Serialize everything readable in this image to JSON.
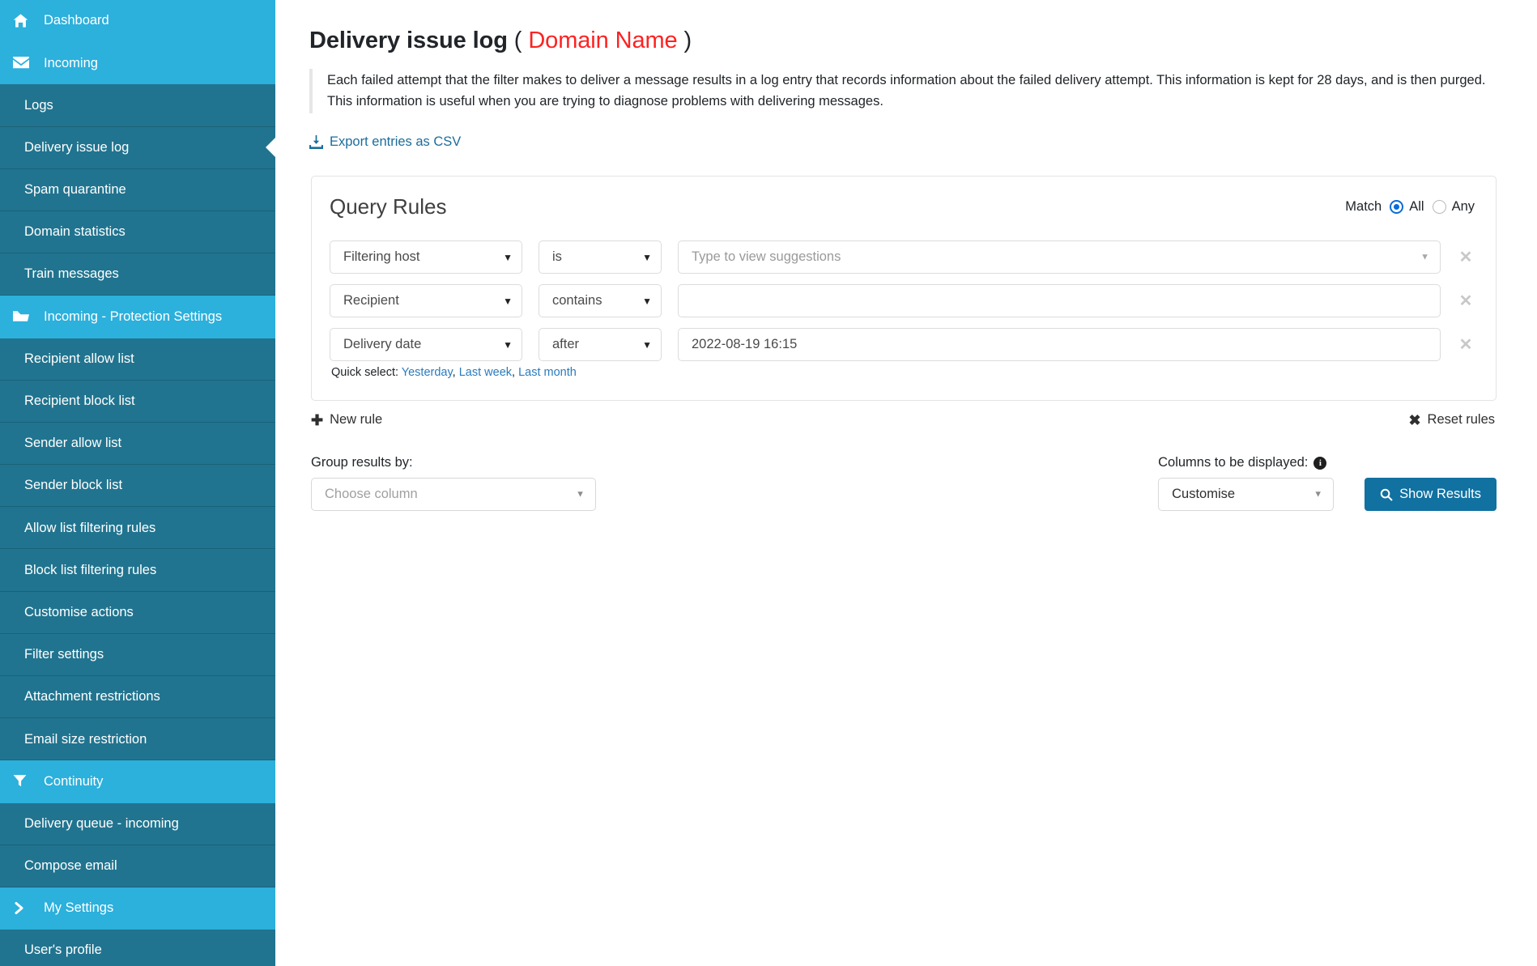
{
  "sidebar": {
    "items": [
      {
        "label": "Dashboard",
        "type": "group",
        "icon": "home-icon",
        "key": "dashboard"
      },
      {
        "label": "Incoming",
        "type": "group",
        "icon": "envelope-icon",
        "key": "incoming"
      },
      {
        "label": "Logs",
        "type": "child",
        "active": false,
        "key": "logs"
      },
      {
        "label": "Delivery issue log",
        "type": "child",
        "active": true,
        "key": "delivery-issue-log"
      },
      {
        "label": "Spam quarantine",
        "type": "child",
        "active": false,
        "key": "spam-quarantine"
      },
      {
        "label": "Domain statistics",
        "type": "child",
        "active": false,
        "key": "domain-statistics"
      },
      {
        "label": "Train messages",
        "type": "child",
        "active": false,
        "key": "train-messages"
      },
      {
        "label": "Incoming - Protection Settings",
        "type": "group",
        "icon": "folder-icon",
        "key": "incoming-protection-settings"
      },
      {
        "label": "Recipient allow list",
        "type": "child",
        "active": false,
        "key": "recipient-allow-list"
      },
      {
        "label": "Recipient block list",
        "type": "child",
        "active": false,
        "key": "recipient-block-list"
      },
      {
        "label": "Sender allow list",
        "type": "child",
        "active": false,
        "key": "sender-allow-list"
      },
      {
        "label": "Sender block list",
        "type": "child",
        "active": false,
        "key": "sender-block-list"
      },
      {
        "label": "Allow list filtering rules",
        "type": "child",
        "active": false,
        "key": "allow-list-filtering-rules"
      },
      {
        "label": "Block list filtering rules",
        "type": "child",
        "active": false,
        "key": "block-list-filtering-rules"
      },
      {
        "label": "Customise actions",
        "type": "child",
        "active": false,
        "key": "customise-actions"
      },
      {
        "label": "Filter settings",
        "type": "child",
        "active": false,
        "key": "filter-settings"
      },
      {
        "label": "Attachment restrictions",
        "type": "child",
        "active": false,
        "key": "attachment-restrictions"
      },
      {
        "label": "Email size restriction",
        "type": "child",
        "active": false,
        "key": "email-size-restriction"
      },
      {
        "label": "Continuity",
        "type": "group",
        "icon": "filter-icon",
        "key": "continuity"
      },
      {
        "label": "Delivery queue - incoming",
        "type": "child",
        "active": false,
        "key": "delivery-queue-incoming"
      },
      {
        "label": "Compose email",
        "type": "child",
        "active": false,
        "key": "compose-email"
      },
      {
        "label": "My Settings",
        "type": "group",
        "icon": "chevron-right-icon",
        "key": "my-settings"
      },
      {
        "label": "User's profile",
        "type": "child",
        "active": false,
        "key": "users-profile"
      }
    ],
    "colors": {
      "group_bg": "#2cb0dc",
      "child_bg": "#21748f",
      "divider": "#1a6278",
      "text": "#ffffff"
    }
  },
  "page": {
    "title_main": "Delivery issue log",
    "title_paren_open": "(",
    "title_domain": "Domain Name",
    "title_paren_close": ")",
    "domain_color": "#fd2222",
    "description": "Each failed attempt that the filter makes to deliver a message results in a log entry that records information about the failed delivery attempt. This information is kept for 28 days, and is then purged. This information is useful when you are trying to diagnose problems with delivering messages.",
    "export_label": "Export entries as CSV",
    "export_icon": "download-icon"
  },
  "query_rules": {
    "panel_title": "Query Rules",
    "match_label": "Match",
    "match_options": [
      {
        "label": "All",
        "selected": true
      },
      {
        "label": "Any",
        "selected": false
      }
    ],
    "accent_color": "#0b6bd8",
    "rows": [
      {
        "field": "Filtering host",
        "operator": "is",
        "value": "",
        "value_placeholder": "Type to view suggestions",
        "has_value_caret": true,
        "remove_icon": "close-icon"
      },
      {
        "field": "Recipient",
        "operator": "contains",
        "value": "",
        "value_placeholder": "",
        "has_value_caret": false,
        "remove_icon": "close-icon"
      },
      {
        "field": "Delivery date",
        "operator": "after",
        "value": "2022-08-19 16:15",
        "value_placeholder": "",
        "has_value_caret": false,
        "remove_icon": "close-icon"
      }
    ],
    "quick_select_label": "Quick select:",
    "quick_select_options": [
      "Yesterday",
      "Last week",
      "Last month"
    ],
    "new_rule_label": "New rule",
    "new_rule_icon": "plus-icon",
    "reset_rules_label": "Reset rules",
    "reset_rules_icon": "close-icon"
  },
  "bottom_controls": {
    "group_by_label": "Group results by:",
    "group_by_value": "Choose column",
    "columns_label": "Columns to be displayed:",
    "columns_info_icon": "info-icon",
    "columns_value": "Customise",
    "show_results_label": "Show Results",
    "show_results_icon": "search-icon",
    "primary_color": "#1171a1"
  }
}
